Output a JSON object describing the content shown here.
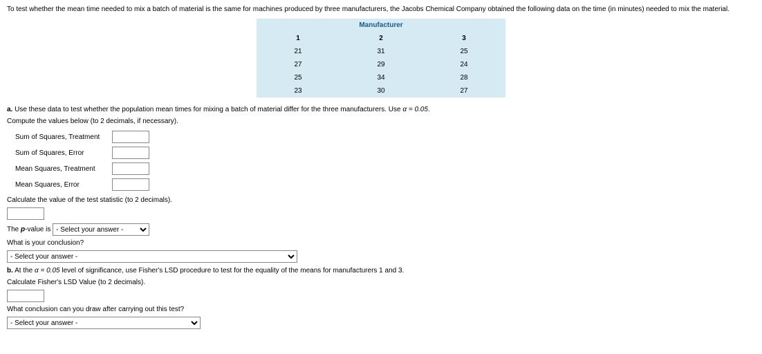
{
  "intro": "To test whether the mean time needed to mix a batch of material is the same for machines produced by three manufacturers, the Jacobs Chemical Company obtained the following data on the time (in minutes) needed to mix the material.",
  "table": {
    "title": "Manufacturer",
    "cols": [
      "1",
      "2",
      "3"
    ],
    "rows": [
      [
        "21",
        "31",
        "25"
      ],
      [
        "27",
        "29",
        "24"
      ],
      [
        "25",
        "34",
        "28"
      ],
      [
        "23",
        "30",
        "27"
      ]
    ]
  },
  "partA": {
    "letter": "a.",
    "text_before_alpha": " Use these data to test whether the population mean times for mixing a batch of material differ for the three manufacturers. Use ",
    "alpha_expr": "α = 0.05",
    "period": ".",
    "compute_line": "Compute the values below (to 2 decimals, if necessary).",
    "metrics": {
      "ss_treatment": "Sum of Squares, Treatment",
      "ss_error": "Sum of Squares, Error",
      "ms_treatment": "Mean Squares, Treatment",
      "ms_error": "Mean Squares, Error"
    },
    "test_stat_line": "Calculate the value of the test statistic (to 2 decimals).",
    "pvalue_prefix": "The ",
    "pvalue_word": "p",
    "pvalue_suffix": "-value is ",
    "select_placeholder": "- Select your answer -",
    "conclusion_q": "What is your conclusion?"
  },
  "partB": {
    "letter": "b.",
    "text1": " At the ",
    "alpha_expr": "α = 0.05",
    "text2": " level of significance, use Fisher's LSD procedure to test for the equality of the means for manufacturers 1 and 3.",
    "lsd_line": "Calculate Fisher's LSD Value (to 2 decimals).",
    "final_q": "What conclusion can you draw after carrying out this test?",
    "select_placeholder": "- Select your answer -"
  }
}
